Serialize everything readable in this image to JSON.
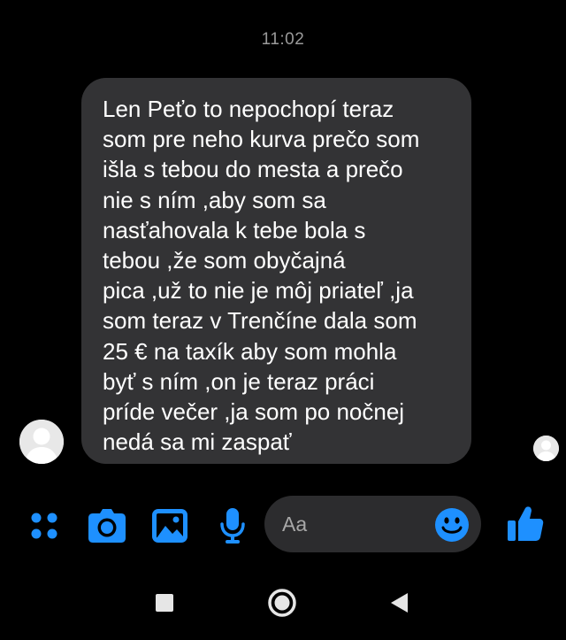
{
  "header": {
    "time": "11:02"
  },
  "message": {
    "text": "Len Peťo to nepochopí teraz\nsom pre neho kurva prečo som\nišla s tebou do mesta a prečo\nnie s ním ,aby som sa\nnasťahovala k tebe bola s\ntebou ,že som obyčajná\npica ,už to nie je môj priateľ ,ja\nsom teraz v Trenčíne dala som\n25 € na taxík aby som mohla\nbyť s ním ,on je teraz práci\npríde večer ,ja som po nočnej\nnedá sa mi zaspať"
  },
  "composer": {
    "placeholder": "Aa",
    "icons": [
      "menu-dots-icon",
      "camera-icon",
      "gallery-icon",
      "microphone-icon",
      "emoji-icon",
      "thumbs-up-icon"
    ]
  },
  "navigation": {
    "icons": [
      "recent-apps-icon",
      "home-icon",
      "back-icon"
    ]
  },
  "colors": {
    "background": "#000000",
    "bubble": "#333335",
    "accent": "#1e90ff",
    "timestamp": "#9a9a9a",
    "input_background": "#2c2c2e"
  }
}
